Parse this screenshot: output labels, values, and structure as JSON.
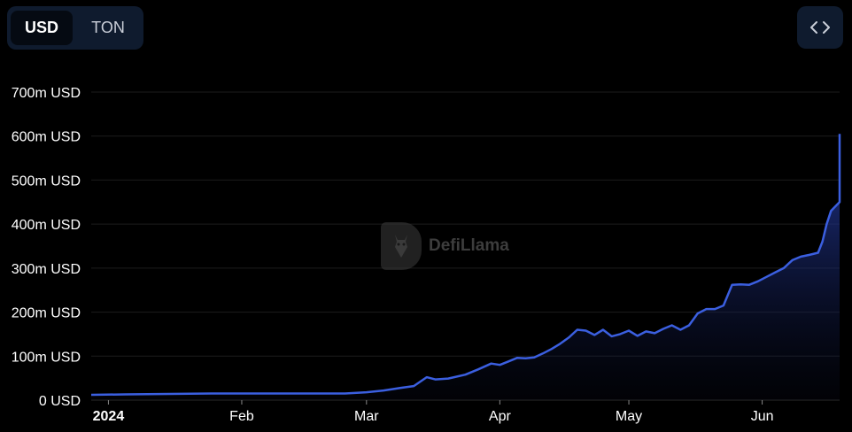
{
  "toggle": {
    "usd_label": "USD",
    "ton_label": "TON",
    "selected": "USD"
  },
  "embed_icon": "code-icon",
  "watermark": {
    "text": "DefiLlama",
    "icon": "llama-logo-icon"
  },
  "colors": {
    "line": "#3b5fe0",
    "fill_top": "#2a44b8",
    "background": "#000000",
    "grid": "#1c1c1c"
  },
  "chart_data": {
    "type": "area",
    "title": "",
    "xlabel": "",
    "ylabel": "",
    "ylim": [
      0,
      700
    ],
    "y_unit": "m USD",
    "y_ticks": [
      {
        "value": 0,
        "label": "0 USD"
      },
      {
        "value": 100,
        "label": "100m USD"
      },
      {
        "value": 200,
        "label": "200m USD"
      },
      {
        "value": 300,
        "label": "300m USD"
      },
      {
        "value": 400,
        "label": "400m USD"
      },
      {
        "value": 500,
        "label": "500m USD"
      },
      {
        "value": 600,
        "label": "600m USD"
      },
      {
        "value": 700,
        "label": "700m USD"
      }
    ],
    "xlim": [
      "2023-12-28",
      "2024-06-19"
    ],
    "x_ticks": [
      {
        "date": "2024-01-01",
        "label": "2024",
        "bold": true
      },
      {
        "date": "2024-02-01",
        "label": "Feb"
      },
      {
        "date": "2024-03-01",
        "label": "Mar"
      },
      {
        "date": "2024-04-01",
        "label": "Apr"
      },
      {
        "date": "2024-05-01",
        "label": "May"
      },
      {
        "date": "2024-06-01",
        "label": "Jun"
      }
    ],
    "grid": true,
    "series": [
      {
        "name": "",
        "points": [
          [
            "2023-12-28",
            12
          ],
          [
            "2024-01-05",
            13
          ],
          [
            "2024-01-15",
            14
          ],
          [
            "2024-01-25",
            15
          ],
          [
            "2024-02-05",
            15
          ],
          [
            "2024-02-15",
            15
          ],
          [
            "2024-02-25",
            15
          ],
          [
            "2024-03-01",
            18
          ],
          [
            "2024-03-05",
            22
          ],
          [
            "2024-03-09",
            28
          ],
          [
            "2024-03-12",
            32
          ],
          [
            "2024-03-15",
            52
          ],
          [
            "2024-03-17",
            47
          ],
          [
            "2024-03-20",
            49
          ],
          [
            "2024-03-24",
            58
          ],
          [
            "2024-03-27",
            70
          ],
          [
            "2024-03-30",
            83
          ],
          [
            "2024-04-01",
            80
          ],
          [
            "2024-04-03",
            88
          ],
          [
            "2024-04-05",
            96
          ],
          [
            "2024-04-07",
            95
          ],
          [
            "2024-04-09",
            97
          ],
          [
            "2024-04-11",
            106
          ],
          [
            "2024-04-13",
            116
          ],
          [
            "2024-04-15",
            128
          ],
          [
            "2024-04-17",
            142
          ],
          [
            "2024-04-19",
            160
          ],
          [
            "2024-04-21",
            158
          ],
          [
            "2024-04-23",
            148
          ],
          [
            "2024-04-25",
            160
          ],
          [
            "2024-04-27",
            145
          ],
          [
            "2024-04-29",
            150
          ],
          [
            "2024-05-01",
            158
          ],
          [
            "2024-05-03",
            146
          ],
          [
            "2024-05-05",
            156
          ],
          [
            "2024-05-07",
            152
          ],
          [
            "2024-05-09",
            162
          ],
          [
            "2024-05-11",
            170
          ],
          [
            "2024-05-13",
            160
          ],
          [
            "2024-05-15",
            170
          ],
          [
            "2024-05-17",
            197
          ],
          [
            "2024-05-19",
            207
          ],
          [
            "2024-05-21",
            207
          ],
          [
            "2024-05-23",
            215
          ],
          [
            "2024-05-25",
            262
          ],
          [
            "2024-05-27",
            263
          ],
          [
            "2024-05-29",
            262
          ],
          [
            "2024-05-31",
            270
          ],
          [
            "2024-06-02",
            280
          ],
          [
            "2024-06-04",
            290
          ],
          [
            "2024-06-06",
            300
          ],
          [
            "2024-06-08",
            318
          ],
          [
            "2024-06-10",
            326
          ],
          [
            "2024-06-12",
            330
          ],
          [
            "2024-06-14",
            335
          ],
          [
            "2024-06-15",
            360
          ],
          [
            "2024-06-16",
            400
          ],
          [
            "2024-06-17",
            430
          ],
          [
            "2024-06-18",
            440
          ],
          [
            "2024-06-19",
            450
          ],
          [
            "2024-06-20",
            500
          ],
          [
            "2024-06-21",
            580
          ],
          [
            "2024-06-22",
            600
          ],
          [
            "2024-06-23",
            605
          ]
        ]
      }
    ]
  }
}
